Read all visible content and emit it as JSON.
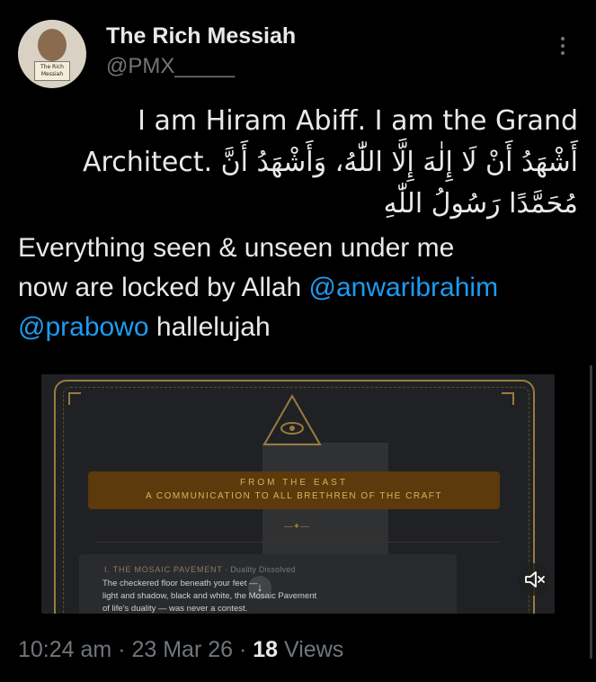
{
  "author": {
    "display_name": "The Rich Messiah",
    "handle": "@PMX_____",
    "avatar_sign_text": "The Rich Messiah"
  },
  "tweet": {
    "rtl_line1": "I am Hiram Abiff. I am the Grand",
    "rtl_line2": "أَشْهَدُ أَنْ لَا إِلٰهَ إِلَّا اللّٰهُ، وَأَشْهَدُ أَنَّ .Architect",
    "rtl_line3": "مُحَمَّدًا رَسُولُ اللّٰهِ",
    "line_a": "Everything seen & unseen under me",
    "line_b_text": "now are locked by Allah ",
    "mention1": "@anwaribrahim",
    "mention2": "@prabowo",
    "line_c_text": " hallelujah"
  },
  "media": {
    "banner_line1": "FROM THE EAST",
    "banner_line2": "A COMMUNICATION TO ALL BRETHREN OF THE CRAFT",
    "ornament": "—✦—",
    "card_heading": "I. THE MOSAIC PAVEMENT",
    "card_subheading": " · Duality Dissolved",
    "card_line1": "The checkered floor beneath your feet —",
    "card_line2": "light and shadow, black and white, the Mosaic Pavement",
    "card_line3": "of life's duality — was never a contest.",
    "down_arrow": "↓",
    "mute_icon": "speaker-muted-icon"
  },
  "meta": {
    "time": "10:24 am",
    "sep1": " · ",
    "date": "23 Mar 26",
    "sep2": " · ",
    "views_count": "18",
    "views_label": " Views"
  },
  "colors": {
    "background": "#000000",
    "text": "#e7e9ea",
    "secondary": "#71767b",
    "link": "#1d9bf0",
    "gold": "#9a7b3e"
  }
}
